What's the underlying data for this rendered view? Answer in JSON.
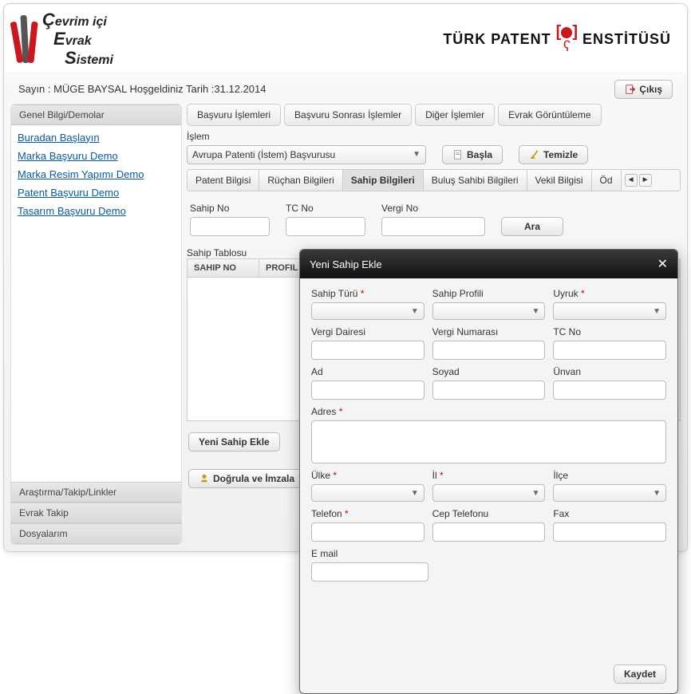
{
  "header": {
    "brand_line1": "evrim içi",
    "brand_line2": "vrak",
    "brand_line3": "istemi",
    "brand_cap1": "Ç",
    "brand_cap2": "E",
    "brand_cap3": "S",
    "right_text_1": "TÜRK PATENT",
    "right_text_2": "ENSTİTÜSÜ"
  },
  "welcome": {
    "text": "Sayın : MÜGE BAYSAL Hoşgeldiniz Tarih :31.12.2014",
    "exit_label": "Çıkış"
  },
  "sidebar": {
    "section1_title": "Genel Bilgi/Demolar",
    "links": [
      "Buradan Başlayın",
      "Marka Başvuru Demo",
      "Marka Resim Yapımı Demo",
      "Patent Başvuru Demo",
      "Tasarım Başvuru Demo"
    ],
    "section2_title": "Araştırma/Takip/Linkler",
    "section3_title": "Evrak Takip",
    "section4_title": "Dosyalarım"
  },
  "main": {
    "top_tabs": [
      "Başvuru İşlemleri",
      "Başvuru Sonrası İşlemler",
      "Diğer İşlemler",
      "Evrak Görüntüleme"
    ],
    "op_label": "İşlem",
    "op_value": "Avrupa Patenti (İstem) Başvurusu",
    "start_label": "Başla",
    "clear_label": "Temizle",
    "sub_tabs": [
      "Patent Bilgisi",
      "Rüçhan Bilgileri",
      "Sahip Bilgileri",
      "Buluş Sahibi Bilgileri",
      "Vekil Bilgisi",
      "Öd"
    ],
    "search": {
      "sahip_no_label": "Sahip No",
      "tc_no_label": "TC No",
      "vergi_no_label": "Vergi No",
      "search_btn": "Ara"
    },
    "table": {
      "caption": "Sahip Tablosu",
      "headers": [
        "SAHIP NO",
        "PROFIL"
      ]
    },
    "new_owner_btn": "Yeni Sahip Ekle",
    "validate_btn": "Doğrula ve İmzala"
  },
  "modal": {
    "title": "Yeni Sahip Ekle",
    "fields": {
      "sahip_turu": "Sahip Türü",
      "sahip_profili": "Sahip Profili",
      "uyruk": "Uyruk",
      "vergi_dairesi": "Vergi Dairesi",
      "vergi_numarasi": "Vergi Numarası",
      "tc_no": "TC No",
      "ad": "Ad",
      "soyad": "Soyad",
      "unvan": "Ünvan",
      "adres": "Adres",
      "ulke": "Ülke",
      "il": "İl",
      "ilce": "İlçe",
      "telefon": "Telefon",
      "cep_telefonu": "Cep Telefonu",
      "fax": "Fax",
      "email": "E mail"
    },
    "save_label": "Kaydet"
  }
}
